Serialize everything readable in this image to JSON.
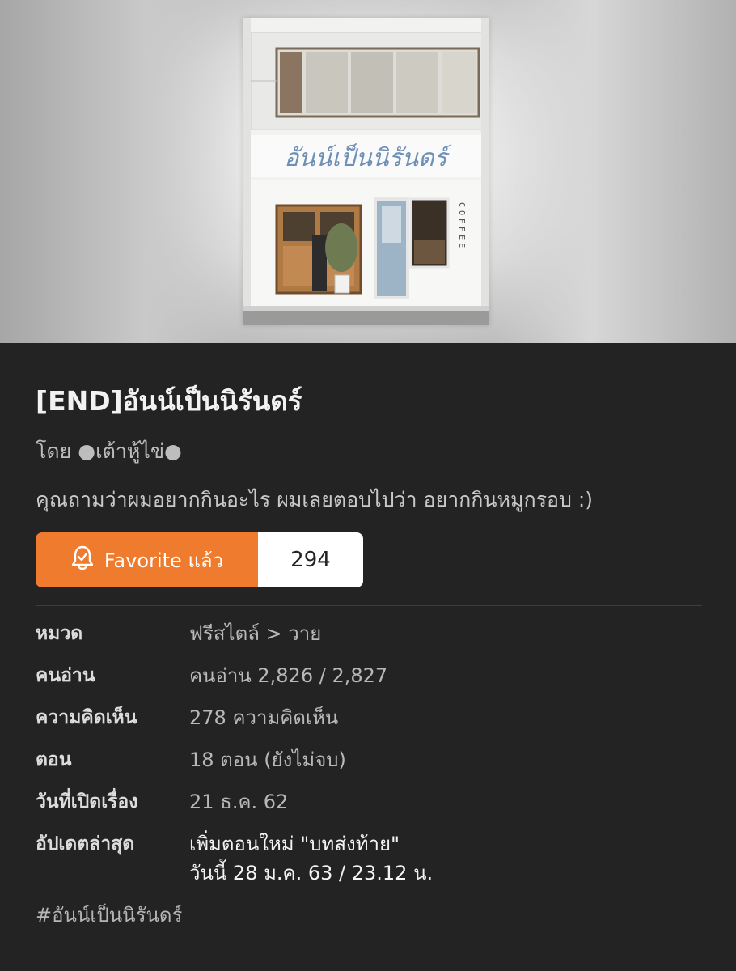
{
  "cover": {
    "sign_text": "อันน์เป็นนิรันดร์",
    "coffee_text": "COFFEE"
  },
  "novel": {
    "title": "[END]อันน์เป็นนิรันดร์",
    "author": "โดย ●เต้าหู้ไข่●",
    "description": "คุณถามว่าผมอยากกินอะไร ผมเลยตอบไปว่า อยากกินหมูกรอบ :)"
  },
  "favorite": {
    "label": "Favorite แล้ว",
    "count": "294",
    "accent": "#ee7b2e"
  },
  "info": {
    "category_label": "หมวด",
    "category_value": "ฟรีสไตล์ > วาย",
    "readers_label": "คนอ่าน",
    "readers_value": "คนอ่าน 2,826 / 2,827",
    "comments_label": "ความคิดเห็น",
    "comments_value": "278 ความคิดเห็น",
    "episodes_label": "ตอน",
    "episodes_value": "18 ตอน (ยังไม่จบ)",
    "opened_label": "วันที่เปิดเรื่อง",
    "opened_value": "21 ธ.ค. 62",
    "updated_label": "อัปเดตล่าสุด",
    "updated_line1": "เพิ่มตอนใหม่ \"บทส่งท้าย\"",
    "updated_line2": "วันนี้ 28 ม.ค. 63 / 23.12 น."
  },
  "hashtag": "#อันน์เป็นนิรันดร์"
}
